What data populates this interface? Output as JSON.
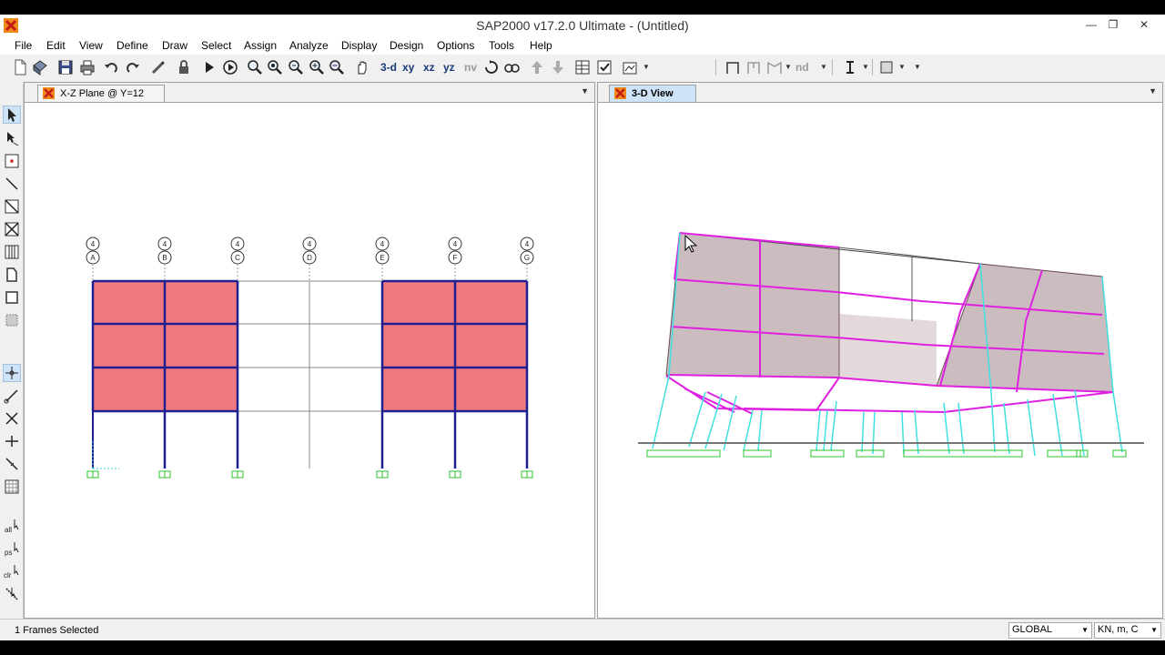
{
  "window": {
    "title": "SAP2000 v17.2.0 Ultimate  - (Untitled)"
  },
  "menu": [
    "File",
    "Edit",
    "View",
    "Define",
    "Draw",
    "Select",
    "Assign",
    "Analyze",
    "Display",
    "Design",
    "Options",
    "Tools",
    "Help"
  ],
  "toolbar": {
    "view_3d": "3-d",
    "view_xy": "xy",
    "view_xz": "xz",
    "view_yz": "yz",
    "view_nv": "nv",
    "view_nd": "nd"
  },
  "left_tools": {
    "select_all": "all",
    "select_ps": "ps",
    "select_clr": "clr"
  },
  "left_pane": {
    "tab_title": "X-Z Plane @ Y=12",
    "grid_top_bubble": "4",
    "grid_bubbles": [
      "A",
      "B",
      "C",
      "D",
      "E",
      "F",
      "G"
    ]
  },
  "right_pane": {
    "tab_title": "3-D View"
  },
  "status": {
    "message": "1 Frames Selected",
    "coord_system": "GLOBAL",
    "units": "KN, m, C"
  },
  "colors": {
    "frame": "#1f1f8f",
    "shell": "#f07880",
    "support": "#2bc42b",
    "magenta": "#e020e0",
    "cyan": "#40e0e0"
  }
}
